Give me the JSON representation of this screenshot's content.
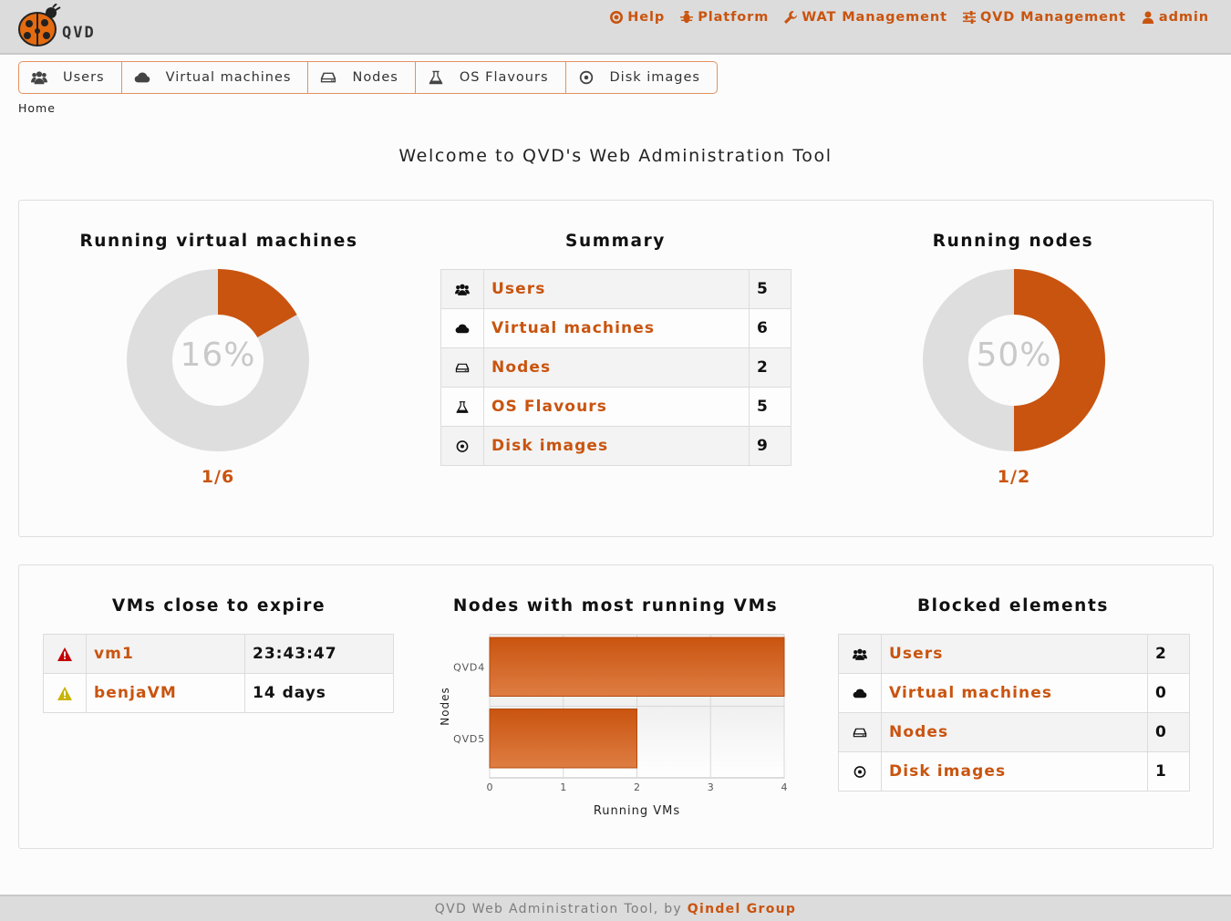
{
  "header": {
    "logo_text": "QVD",
    "menu": [
      {
        "label": "Help",
        "icon": "help-icon"
      },
      {
        "label": "Platform",
        "icon": "bug-icon"
      },
      {
        "label": "WAT Management",
        "icon": "wrench-icon"
      },
      {
        "label": "QVD Management",
        "icon": "sliders-icon"
      },
      {
        "label": "admin",
        "icon": "user-icon"
      }
    ]
  },
  "tabs": [
    {
      "label": "Users",
      "icon": "users-icon"
    },
    {
      "label": "Virtual machines",
      "icon": "cloud-icon"
    },
    {
      "label": "Nodes",
      "icon": "hdd-icon"
    },
    {
      "label": "OS Flavours",
      "icon": "flask-icon"
    },
    {
      "label": "Disk images",
      "icon": "disk-icon"
    }
  ],
  "breadcrumb": "Home",
  "welcome": "Welcome to QVD's Web Administration Tool",
  "running_vms": {
    "title": "Running virtual machines",
    "percent_label": "16%",
    "fraction": "1/6",
    "running": 1,
    "total": 6
  },
  "summary": {
    "title": "Summary",
    "rows": [
      {
        "label": "Users",
        "value": "5",
        "icon": "users-icon"
      },
      {
        "label": "Virtual machines",
        "value": "6",
        "icon": "cloud-icon"
      },
      {
        "label": "Nodes",
        "value": "2",
        "icon": "hdd-icon"
      },
      {
        "label": "OS Flavours",
        "value": "5",
        "icon": "flask-icon"
      },
      {
        "label": "Disk images",
        "value": "9",
        "icon": "disk-icon"
      }
    ]
  },
  "running_nodes": {
    "title": "Running nodes",
    "percent_label": "50%",
    "fraction": "1/2",
    "running": 1,
    "total": 2
  },
  "expire": {
    "title": "VMs close to expire",
    "rows": [
      {
        "name": "vm1",
        "time": "23:43:47",
        "icon": "warning-red-icon",
        "color": "#c40000"
      },
      {
        "name": "benjaVM",
        "time": "14 days",
        "icon": "warning-yellow-icon",
        "color": "#c9b400"
      }
    ]
  },
  "nodes_chart": {
    "title": "Nodes with most running VMs"
  },
  "chart_data": {
    "type": "bar",
    "orientation": "horizontal",
    "categories": [
      "QVD4",
      "QVD5"
    ],
    "values": [
      4,
      2
    ],
    "xlabel": "Running VMs",
    "ylabel": "Nodes",
    "xlim": [
      0,
      4
    ],
    "xticks": [
      "0",
      "1",
      "2",
      "3",
      "4"
    ],
    "grid": true
  },
  "blocked": {
    "title": "Blocked elements",
    "rows": [
      {
        "label": "Users",
        "value": "2",
        "icon": "users-icon"
      },
      {
        "label": "Virtual machines",
        "value": "0",
        "icon": "cloud-icon"
      },
      {
        "label": "Nodes",
        "value": "0",
        "icon": "hdd-icon"
      },
      {
        "label": "Disk images",
        "value": "1",
        "icon": "disk-icon"
      }
    ]
  },
  "footer": {
    "text": "QVD Web Administration Tool, by",
    "brand": "Qindel Group"
  },
  "colors": {
    "accent": "#c9540f",
    "donut_track": "#dedede"
  }
}
